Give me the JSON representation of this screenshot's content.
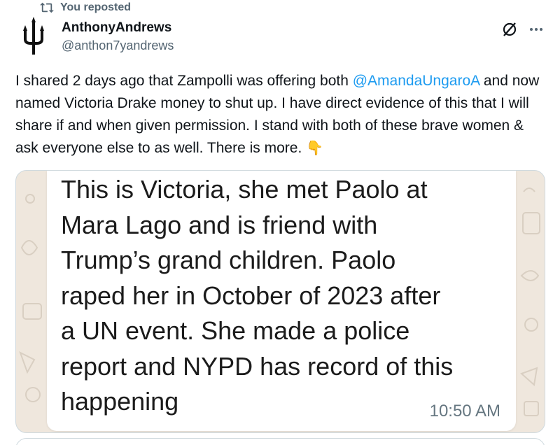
{
  "repost": {
    "label": "You reposted",
    "icon": "repost-icon"
  },
  "author": {
    "display_name": "AnthonyAndrews",
    "handle": "@anthon7yandrews",
    "avatar_icon": "trident-avatar"
  },
  "header": {
    "grok_icon": "grok-icon",
    "more_icon": "more-icon"
  },
  "tweet": {
    "text_part1": "I shared 2 days ago that Zampolli was offering both ",
    "mention": "@AmandaUngaroA",
    "text_part2": " and now named Victoria Drake money to shut up. I have direct evidence of this that I will share if and when given permission. I stand with both of these brave women & ask everyone else to as well. There is more. ",
    "emoji": "👇"
  },
  "media": {
    "message_lines": [
      "This is Victoria, she met Paolo at",
      "Mara Lago and is friend with",
      "Trump’s grand children. Paolo",
      "raped her in October of 2023 after",
      "a UN event. She made a police",
      "report and NYPD has record of this",
      "happening"
    ],
    "time": "10:50 AM"
  },
  "colors": {
    "accent": "#1d9bf0",
    "secondary_text": "#536471",
    "chat_background": "#efe7dd"
  }
}
